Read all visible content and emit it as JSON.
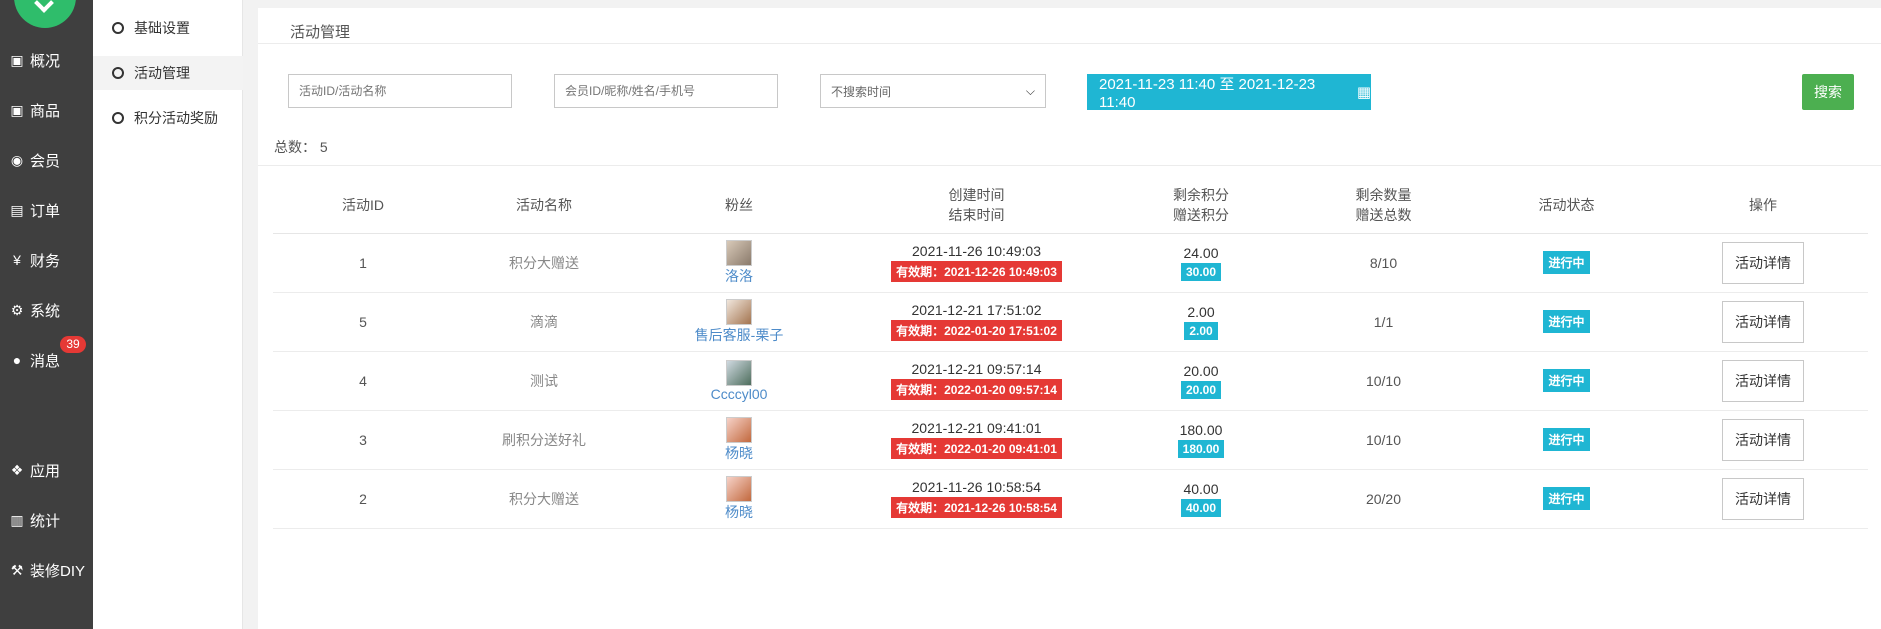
{
  "sidebar": {
    "items": [
      {
        "label": "概况",
        "icon": "box-icon"
      },
      {
        "label": "商品",
        "icon": "box-icon"
      },
      {
        "label": "会员",
        "icon": "users-icon"
      },
      {
        "label": "订单",
        "icon": "cart-icon"
      },
      {
        "label": "财务",
        "icon": "yen-icon"
      },
      {
        "label": "系统",
        "icon": "gears-icon"
      },
      {
        "label": "消息",
        "icon": "comment-icon"
      },
      {
        "label": "应用",
        "icon": "cubes-icon"
      },
      {
        "label": "统计",
        "icon": "bar-chart-icon"
      },
      {
        "label": "装修DIY",
        "icon": "gavel-icon"
      }
    ],
    "message_badge": "39"
  },
  "subnav": {
    "items": [
      {
        "label": "基础设置"
      },
      {
        "label": "活动管理"
      },
      {
        "label": "积分活动奖励"
      }
    ]
  },
  "main": {
    "title": "活动管理",
    "filters": {
      "activity_placeholder": "活动ID/活动名称",
      "member_placeholder": "会员ID/昵称/姓名/手机号",
      "time_select": "不搜索时间",
      "date_range": "2021-11-23 11:40 至 2021-12-23 11:40",
      "search_label": "搜索"
    },
    "total_label": "总数：",
    "total_value": "5",
    "columns": {
      "id": "活动ID",
      "name": "活动名称",
      "fans": "粉丝",
      "time_1": "创建时间",
      "time_2": "结束时间",
      "points_1": "剩余积分",
      "points_2": "赠送积分",
      "qty_1": "剩余数量",
      "qty_2": "赠送总数",
      "status": "活动状态",
      "action": "操作"
    },
    "rows": [
      {
        "id": "1",
        "name": "积分大赠送",
        "fan": "洛洛",
        "created": "2021-11-26 10:49:03",
        "end": "有效期：2021-12-26 10:49:03",
        "remain_points": "24.00",
        "give_points": "30.00",
        "qty": "8/10",
        "status": "进行中",
        "action": "活动详情"
      },
      {
        "id": "5",
        "name": "滴滴",
        "fan": "售后客服-栗子",
        "created": "2021-12-21 17:51:02",
        "end": "有效期：2022-01-20 17:51:02",
        "remain_points": "2.00",
        "give_points": "2.00",
        "qty": "1/1",
        "status": "进行中",
        "action": "活动详情"
      },
      {
        "id": "4",
        "name": "测试",
        "fan": "Ccccyl00",
        "created": "2021-12-21 09:57:14",
        "end": "有效期：2022-01-20 09:57:14",
        "remain_points": "20.00",
        "give_points": "20.00",
        "qty": "10/10",
        "status": "进行中",
        "action": "活动详情"
      },
      {
        "id": "3",
        "name": "刷积分送好礼",
        "fan": "杨晓",
        "created": "2021-12-21 09:41:01",
        "end": "有效期：2022-01-20 09:41:01",
        "remain_points": "180.00",
        "give_points": "180.00",
        "qty": "10/10",
        "status": "进行中",
        "action": "活动详情"
      },
      {
        "id": "2",
        "name": "积分大赠送",
        "fan": "杨晓",
        "created": "2021-11-26 10:58:54",
        "end": "有效期：2021-12-26 10:58:54",
        "remain_points": "40.00",
        "give_points": "40.00",
        "qty": "20/20",
        "status": "进行中",
        "action": "活动详情"
      }
    ]
  }
}
